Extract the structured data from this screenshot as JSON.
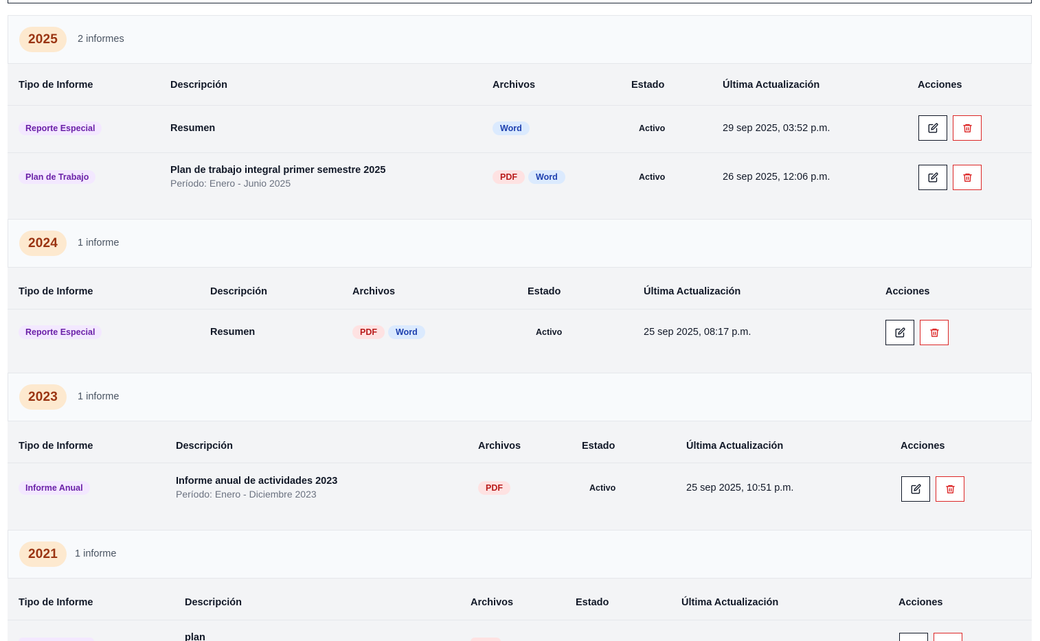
{
  "columns": {
    "type": "Tipo de Informe",
    "description": "Descripción",
    "files": "Archivos",
    "status": "Estado",
    "updated": "Última Actualización",
    "actions": "Acciones"
  },
  "groups": [
    {
      "year": "2025",
      "count": "2 informes",
      "rows": [
        {
          "type": "Reporte Especial",
          "description": "Resumen",
          "period": "",
          "files": [
            "Word"
          ],
          "status": "Activo",
          "updated": "29 sep 2025, 03:52 p.m."
        },
        {
          "type": "Plan de Trabajo",
          "description": "Plan de trabajo integral primer semestre 2025",
          "period": "Período: Enero - Junio 2025",
          "files": [
            "PDF",
            "Word"
          ],
          "status": "Activo",
          "updated": "26 sep 2025, 12:06 p.m."
        }
      ]
    },
    {
      "year": "2024",
      "count": "1 informe",
      "rows": [
        {
          "type": "Reporte Especial",
          "description": "Resumen",
          "period": "",
          "files": [
            "PDF",
            "Word"
          ],
          "status": "Activo",
          "updated": "25 sep 2025, 08:17 p.m."
        }
      ]
    },
    {
      "year": "2023",
      "count": "1 informe",
      "rows": [
        {
          "type": "Informe Anual",
          "description": "Informe anual de actividades 2023",
          "period": "Período: Enero - Diciembre 2023",
          "files": [
            "PDF"
          ],
          "status": "Activo",
          "updated": "25 sep 2025, 10:51 p.m."
        }
      ]
    },
    {
      "year": "2021",
      "count": "1 informe",
      "rows": [
        {
          "type": "",
          "description": "plan",
          "period": "",
          "files": [],
          "status": "",
          "updated": ""
        }
      ]
    }
  ],
  "icons": {
    "edit": "edit-icon",
    "delete": "trash-icon"
  },
  "colors": {
    "year_pill_bg": "#fde9cf",
    "year_pill_text": "#9a3412",
    "type_badge_bg": "#f3e8ff",
    "type_badge_text": "#6b21a8",
    "pdf_bg": "#fee2e2",
    "pdf_text": "#b91c1c",
    "word_bg": "#dbeafe",
    "word_text": "#1e40af",
    "delete_border": "#dc2626"
  }
}
